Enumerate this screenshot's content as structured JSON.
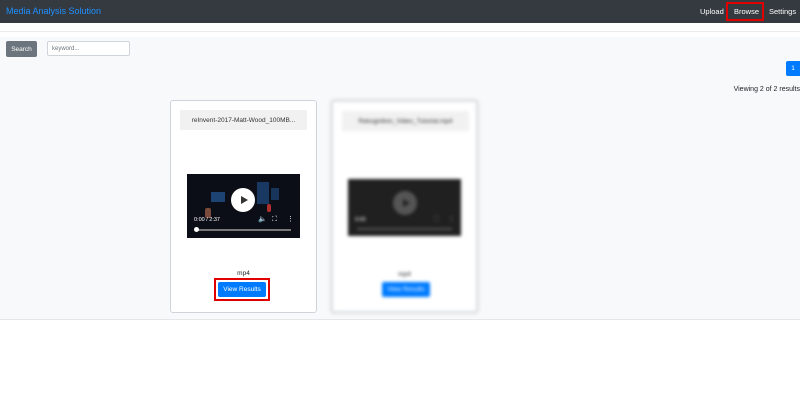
{
  "navbar": {
    "brand": "Media Analysis Solution",
    "links": [
      "Upload",
      "Browse",
      "Settings"
    ]
  },
  "search": {
    "button_label": "Search",
    "placeholder": "keyword..."
  },
  "pagination": {
    "current_page": "1"
  },
  "results": {
    "summary": "Viewing 2 of 2 results"
  },
  "cards": [
    {
      "title": "reInvent-2017-Matt-Wood_100MB...",
      "time": "0:00 / 2:37",
      "format": "mp4",
      "button_label": "View Results"
    },
    {
      "title": "Rekognition_Video_Tutorial.mp4",
      "time": "0:00",
      "format": "mp4",
      "button_label": "View Results"
    }
  ],
  "colors": {
    "navbar": "#343a40",
    "brand": "#1e90ff",
    "primary": "#007bff",
    "highlight": "#e00000"
  },
  "icons": [
    "play-icon",
    "volume-icon",
    "fullscreen-icon",
    "more-options-icon"
  ]
}
